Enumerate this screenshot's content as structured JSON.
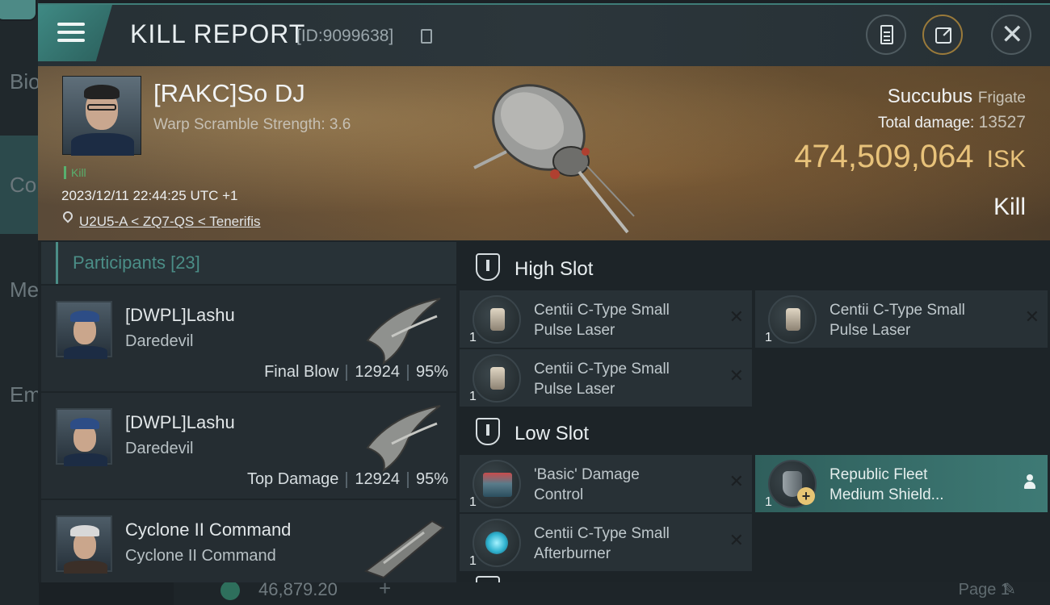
{
  "background": {
    "sidebar_labels": [
      "Bio",
      "Co",
      "Me",
      "Em"
    ],
    "balance": "46,879.20",
    "page_label": "Page 1"
  },
  "header": {
    "title": "KILL REPORT",
    "report_id": "[ID:9099638]",
    "icons": [
      "menu-icon",
      "copy-icon",
      "clipboard-icon",
      "share-icon",
      "close-icon"
    ]
  },
  "victim": {
    "name": "[RAKC]So DJ",
    "warp_scramble": "Warp Scramble Strength: 3.6",
    "tag": "Kill",
    "datetime": "2023/12/11 22:44:25 UTC +1",
    "location": "U2U5-A < ZQ7-QS < Tenerifis",
    "ship_name": "Succubus",
    "ship_class": "Frigate",
    "total_damage_label": "Total damage:",
    "total_damage": "13527",
    "isk_value": "474,509,064",
    "isk_unit": "ISK",
    "result": "Kill"
  },
  "participants": {
    "title": "Participants",
    "count": "[23]",
    "rows": [
      {
        "name": "[DWPL]Lashu",
        "ship": "Daredevil",
        "role": "Final Blow",
        "damage": "12924",
        "percent": "95%"
      },
      {
        "name": "[DWPL]Lashu",
        "ship": "Daredevil",
        "role": "Top Damage",
        "damage": "12924",
        "percent": "95%"
      },
      {
        "name": "Cyclone II Command",
        "ship": "Cyclone II Command",
        "role": "",
        "damage": "",
        "percent": ""
      }
    ]
  },
  "slots": {
    "high": {
      "label": "High Slot",
      "modules": [
        {
          "name": "Centii C-Type Small\nPulse Laser",
          "qty": "1"
        },
        {
          "name": "Centii C-Type Small\nPulse Laser",
          "qty": "1"
        },
        {
          "name": "Centii C-Type Small\nPulse Laser",
          "qty": "1"
        }
      ]
    },
    "low": {
      "label": "Low Slot",
      "modules": [
        {
          "name": "'Basic' Damage\nControl",
          "qty": "1"
        },
        {
          "name": "Republic Fleet\nMedium Shield...",
          "qty": "1"
        },
        {
          "name": "Centii C-Type Small\nAfterburner",
          "qty": "1"
        }
      ]
    }
  },
  "colors": {
    "accent": "#3f8a84",
    "isk": "#e8c27a",
    "kill_green": "#58b06e"
  }
}
